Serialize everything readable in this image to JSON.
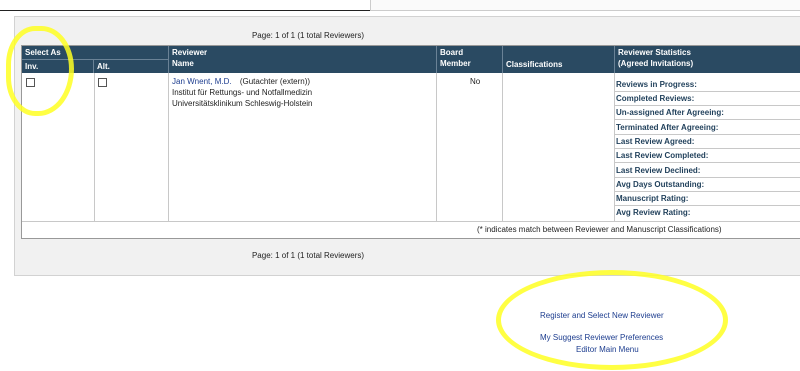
{
  "paging": {
    "top": "Page: 1 of 1 (1 total Reviewers)",
    "bottom": "Page: 1 of 1 (1 total Reviewers)"
  },
  "table": {
    "headers": {
      "select_as": "Select As",
      "inv": "Inv.",
      "alt": "Alt.",
      "reviewer": "Reviewer",
      "name": "Name",
      "board": "Board",
      "member": "Member",
      "classifications": "Classifications",
      "stats_line1": "Reviewer Statistics",
      "stats_line2": "(Agreed Invitations)"
    },
    "row": {
      "reviewer_name": "Jan Wnent, M.D.",
      "reviewer_role": "(Gutachter (extern))",
      "institution_line1": "Institut für Rettungs- und Notfallmedizin",
      "institution_line2": "Universitätsklinikum Schleswig-Holstein",
      "board_member": "No",
      "stats": [
        "Reviews in Progress:",
        "Completed Reviews:",
        "Un-assigned After Agreeing:",
        "Terminated After Agreeing:",
        "Last Review Agreed:",
        "Last Review Completed:",
        "Last Review Declined:",
        "Avg Days Outstanding:",
        "Manuscript Rating:",
        "Avg Review Rating:"
      ]
    },
    "footnote": "(* indicates match between Reviewer and Manuscript Classifications)"
  },
  "links": {
    "register_new": "Register and Select New Reviewer",
    "suggest_prefs": "My Suggest Reviewer Preferences",
    "editor_menu": "Editor Main Menu"
  },
  "colors": {
    "header_bg": "#2a4a62",
    "header_text": "#ffffff",
    "highlight": "#ffff22",
    "link": "#1d3d8f"
  }
}
